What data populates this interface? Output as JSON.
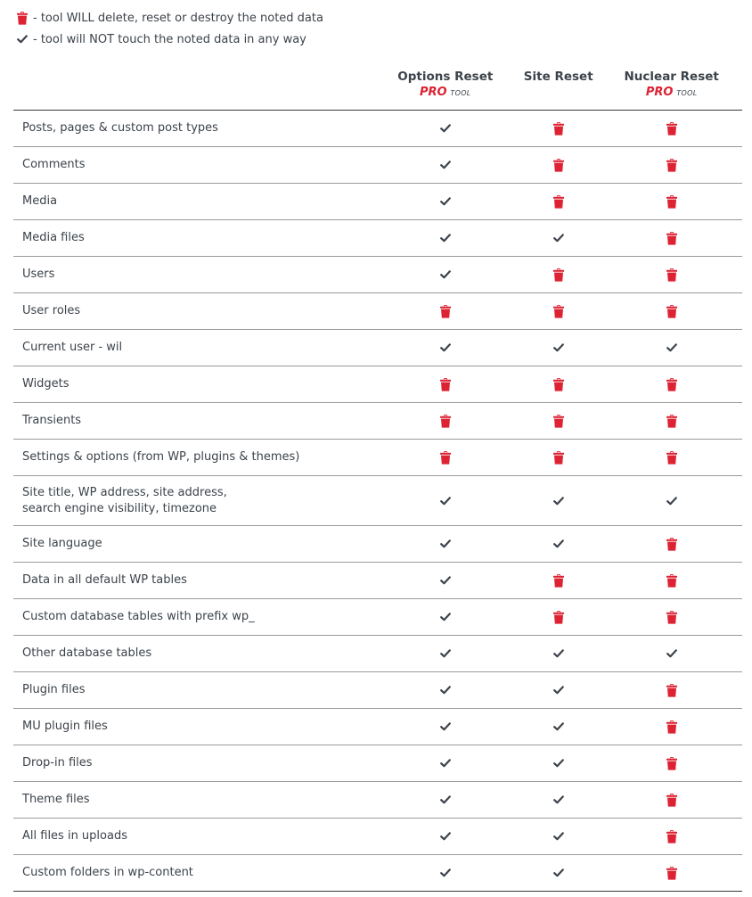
{
  "legend": [
    {
      "icon": "trash-icon",
      "text": "- tool WILL delete, reset or destroy the noted data"
    },
    {
      "icon": "check-icon",
      "text": "- tool will NOT touch the noted data in any way"
    }
  ],
  "colors": {
    "trash": "#dd2233",
    "check": "#3c434a",
    "text": "#3c434a",
    "pro": "#dd2233"
  },
  "table": {
    "columns": [
      {
        "title": "Options Reset",
        "pro": "PRO",
        "tool": "tool"
      },
      {
        "title": "Site Reset",
        "pro": null,
        "tool": null
      },
      {
        "title": "Nuclear Reset",
        "pro": "PRO",
        "tool": "tool"
      }
    ],
    "rows": [
      {
        "label": "Posts, pages & custom post types",
        "values": [
          "check",
          "trash",
          "trash"
        ]
      },
      {
        "label": "Comments",
        "values": [
          "check",
          "trash",
          "trash"
        ]
      },
      {
        "label": "Media",
        "values": [
          "check",
          "trash",
          "trash"
        ]
      },
      {
        "label": "Media files",
        "values": [
          "check",
          "check",
          "trash"
        ]
      },
      {
        "label": "Users",
        "values": [
          "check",
          "trash",
          "trash"
        ]
      },
      {
        "label": "User roles",
        "values": [
          "trash",
          "trash",
          "trash"
        ]
      },
      {
        "label": "Current user - wil",
        "values": [
          "check",
          "check",
          "check"
        ]
      },
      {
        "label": "Widgets",
        "values": [
          "trash",
          "trash",
          "trash"
        ]
      },
      {
        "label": "Transients",
        "values": [
          "trash",
          "trash",
          "trash"
        ]
      },
      {
        "label": "Settings & options (from WP, plugins & themes)",
        "values": [
          "trash",
          "trash",
          "trash"
        ]
      },
      {
        "label": "Site title, WP address, site address,",
        "label2": "search engine visibility, timezone",
        "values": [
          "check",
          "check",
          "check"
        ]
      },
      {
        "label": "Site language",
        "values": [
          "check",
          "check",
          "trash"
        ]
      },
      {
        "label": "Data in all default WP tables",
        "values": [
          "check",
          "trash",
          "trash"
        ]
      },
      {
        "label": "Custom database tables with prefix wp_",
        "values": [
          "check",
          "trash",
          "trash"
        ]
      },
      {
        "label": "Other database tables",
        "values": [
          "check",
          "check",
          "check"
        ]
      },
      {
        "label": "Plugin files",
        "values": [
          "check",
          "check",
          "trash"
        ]
      },
      {
        "label": "MU plugin files",
        "values": [
          "check",
          "check",
          "trash"
        ]
      },
      {
        "label": "Drop-in files",
        "values": [
          "check",
          "check",
          "trash"
        ]
      },
      {
        "label": "Theme files",
        "values": [
          "check",
          "check",
          "trash"
        ]
      },
      {
        "label": "All files in uploads",
        "values": [
          "check",
          "check",
          "trash"
        ]
      },
      {
        "label": "Custom folders in wp-content",
        "values": [
          "check",
          "check",
          "trash"
        ]
      }
    ]
  }
}
